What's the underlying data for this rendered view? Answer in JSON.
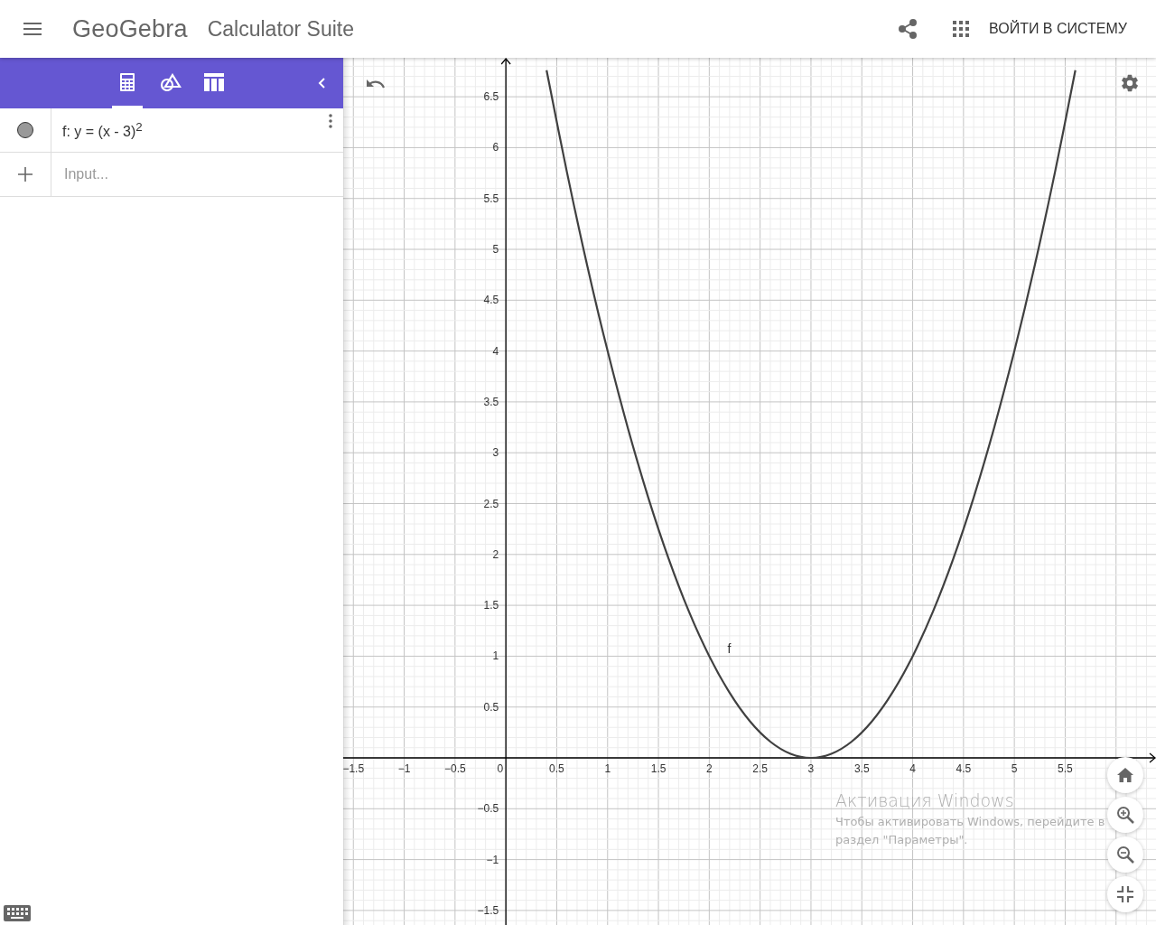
{
  "header": {
    "app_name": "GeoGebra",
    "title": "Calculator Suite",
    "login_button": "ВОЙТИ В СИСТЕМУ"
  },
  "sidebar": {
    "tabs": [
      {
        "kind": "algebra",
        "selected": true
      },
      {
        "kind": "tools",
        "selected": false
      },
      {
        "kind": "table",
        "selected": false
      }
    ],
    "items": [
      {
        "definition": "f: y = (x - 3)$^{2}$",
        "visible": true
      }
    ],
    "input": {
      "placeholder": "Input..."
    }
  },
  "graphics": {
    "chart_data": {
      "type": "line",
      "grid": true,
      "x": [
        0.4,
        0.6,
        0.8,
        1.0,
        1.2,
        1.4,
        1.6,
        1.8,
        2.0,
        2.2,
        2.4,
        2.6,
        2.8,
        3.0,
        3.2,
        3.4,
        3.6,
        3.8,
        4.0,
        4.2,
        4.4,
        4.6,
        4.8,
        5.0,
        5.2,
        5.4,
        5.6
      ],
      "series": [
        {
          "name": "f",
          "color": "#404040",
          "values": [
            6.76,
            5.76,
            4.84,
            4,
            3.24,
            2.56,
            1.96,
            1.44,
            1,
            0.64,
            0.36,
            0.16,
            0.04,
            0,
            0.04,
            0.16,
            0.36,
            0.64,
            1,
            1.44,
            1.96,
            2.56,
            3.24,
            4,
            4.84,
            5.76,
            6.76
          ]
        }
      ],
      "xlim": [
        -1.6,
        6.393
      ],
      "ylim": [
        -1.643,
        6.883
      ],
      "xticks": [
        {
          "value": -1.5,
          "label": "−1.5"
        },
        {
          "value": -1,
          "label": "−1"
        },
        {
          "value": -0.5,
          "label": "−0.5"
        },
        0,
        0.5,
        1,
        1.5,
        2,
        2.5,
        3,
        3.5,
        4,
        4.5,
        5,
        5.5
      ],
      "yticks": [
        {
          "value": -1.5,
          "label": "−1.5"
        },
        {
          "value": -1,
          "label": "−1"
        },
        {
          "value": -0.5,
          "label": "−0.5"
        },
        0.5,
        1,
        1.5,
        2,
        2.5,
        3,
        3.5,
        4,
        4.5,
        5,
        5.5,
        6,
        6.5
      ]
    }
  },
  "system_overlay": {
    "title": "Активация Windows",
    "message": "Чтобы активировать Windows, перейдите в раздел \"Параметры\"."
  }
}
